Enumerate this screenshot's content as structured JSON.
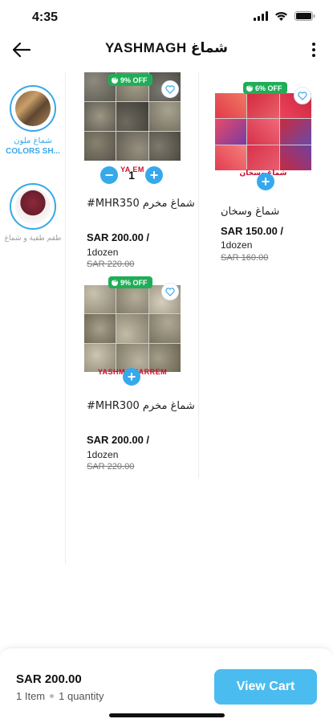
{
  "status_bar": {
    "time": "4:35"
  },
  "header": {
    "title": "YASHMAGH شماغ"
  },
  "categories": [
    {
      "label_ar": "شماغ ملون",
      "label_en": "COLORS SH...",
      "active": true
    },
    {
      "label_ar": "طقم طقية و شماغ",
      "label_en": "",
      "active": false
    }
  ],
  "products": [
    {
      "discount": "9% OFF",
      "brand": "YA          EM",
      "quantity": "1",
      "name": "#MHR350 شماغ مخرم",
      "price": "SAR 200.00 /",
      "unit": "1dozen",
      "old_price": "SAR 220.00"
    },
    {
      "discount": "6% OFF",
      "brand": "شماغ وسخان",
      "name": "شماغ وسخان",
      "price": "SAR 150.00 /",
      "unit": "1dozen",
      "old_price": "SAR 160.00"
    },
    {
      "discount": "9% OFF",
      "brand": "YASHMA    HARREM",
      "name": "#MHR300 شماغ مخرم",
      "price": "SAR 200.00 /",
      "unit": "1dozen",
      "old_price": "SAR 220.00"
    }
  ],
  "cart": {
    "total": "SAR 200.00",
    "items": "1 Item",
    "quantity": "1 quantity",
    "button_label": "View Cart"
  },
  "colors": {
    "accent": "#36a9ec",
    "discount": "#1fae57",
    "brand_red": "#c8102e"
  },
  "icons": {
    "back": "arrow-left-icon",
    "more": "more-vertical-icon",
    "wishlist": "heart-icon",
    "add": "plus-icon",
    "remove": "minus-icon"
  }
}
